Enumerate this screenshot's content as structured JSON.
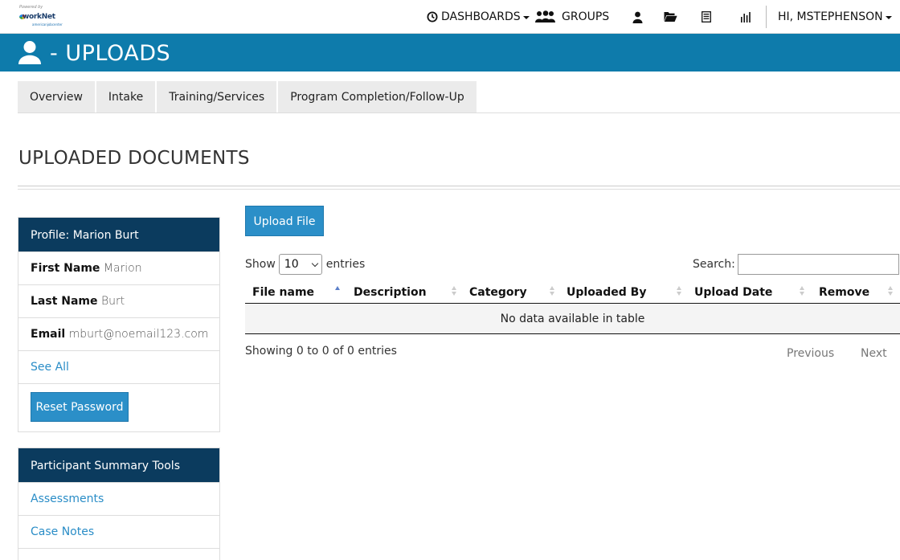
{
  "logo": {
    "powered_by": "Powered by",
    "name": "workNet",
    "tagline": "americanjobcenter"
  },
  "topnav": {
    "dashboards": "DASHBOARDS",
    "groups": "GROUPS",
    "user_greeting": "HI, MSTEPHENSON"
  },
  "header": {
    "title": "- UPLOADS"
  },
  "tabs": [
    {
      "label": "Overview"
    },
    {
      "label": "Intake"
    },
    {
      "label": "Training/Services"
    },
    {
      "label": "Program Completion/Follow-Up"
    }
  ],
  "section_title": "UPLOADED DOCUMENTS",
  "profile": {
    "heading": "Profile: Marion Burt",
    "first_name_label": "First Name",
    "first_name": "Marion",
    "last_name_label": "Last Name",
    "last_name": "Burt",
    "email_label": "Email",
    "email": "mburt@noemail123.com",
    "see_all": "See All",
    "reset_password": "Reset Password"
  },
  "tools": {
    "heading": "Participant Summary Tools",
    "items": [
      {
        "label": "Assessments"
      },
      {
        "label": "Case Notes"
      }
    ]
  },
  "uploads": {
    "upload_button": "Upload File",
    "show_label": "Show",
    "entries_value": "10",
    "entries_label": "entries",
    "search_label": "Search:",
    "columns": [
      {
        "label": "File name"
      },
      {
        "label": "Description"
      },
      {
        "label": "Category"
      },
      {
        "label": "Uploaded By"
      },
      {
        "label": "Upload Date"
      },
      {
        "label": "Remove"
      }
    ],
    "empty_message": "No data available in table",
    "info": "Showing 0 to 0 of 0 entries",
    "previous": "Previous",
    "next": "Next"
  },
  "colors": {
    "header_band": "#0e7bab",
    "panel_head": "#0b3b5e",
    "button": "#2b8fc8",
    "link": "#2a8dc7"
  }
}
